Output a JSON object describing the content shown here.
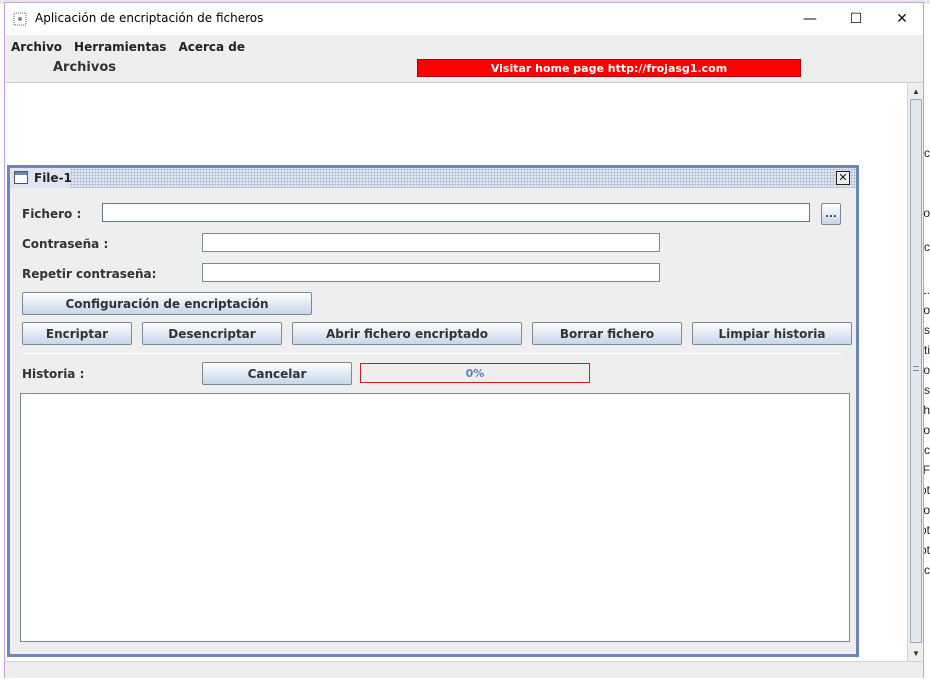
{
  "window": {
    "title": "Aplicación de encriptación de ficheros",
    "minimize": "—",
    "maximize": "☐",
    "close": "✕"
  },
  "menu": [
    "Archivo",
    "Herramientas",
    "Acerca de"
  ],
  "toolbar": {
    "section_label": "Archivos",
    "home_page_button": "Visitar home page http://frojasg1.com",
    "home_page_color": "#ff0000"
  },
  "internal_frame": {
    "title": "File-1",
    "close_label": "✕",
    "file_label": "Fichero :",
    "file_value": "",
    "browse_label": "...",
    "password_label": "Contraseña :",
    "password_value": "",
    "repeat_password_label": "Repetir contraseña:",
    "repeat_password_value": "",
    "config_button": "Configuración de encriptación",
    "actions": {
      "encrypt": "Encriptar",
      "decrypt": "Desencriptar",
      "open_encrypted": "Abrir fichero encriptado",
      "delete_file": "Borrar fichero",
      "clear_history": "Limpiar historia"
    },
    "history_label": "Historia :",
    "cancel_button": "Cancelar",
    "progress": {
      "value": 0,
      "text": "0%",
      "border_color": "#cc2020"
    },
    "history_text": ""
  },
  "background_edge_letters": [
    "c",
    "o",
    "c",
    ".1",
    "o",
    "s",
    "ti",
    "ıo",
    "s.",
    "sh",
    "o",
    "c",
    "F",
    "ot",
    "o",
    "ot",
    "ot",
    "c"
  ]
}
